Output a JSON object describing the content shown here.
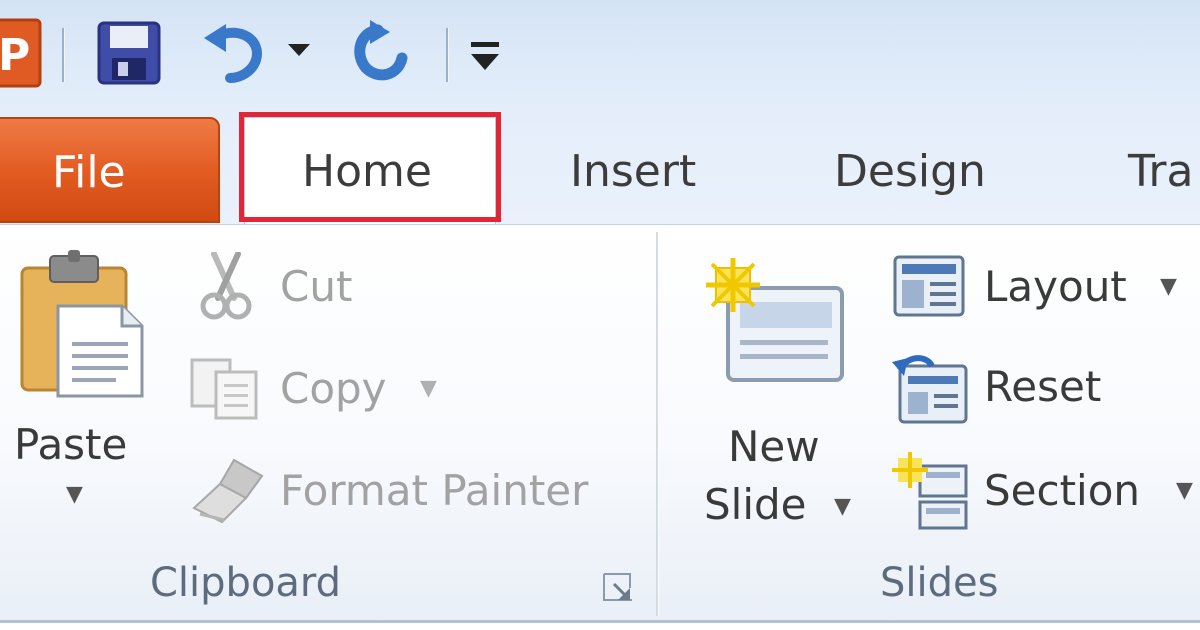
{
  "qat": {
    "save": "save-icon",
    "undo": "undo-icon",
    "redo": "redo-icon"
  },
  "tabs": {
    "file": "File",
    "home": "Home",
    "insert": "Insert",
    "design": "Design",
    "transitions": "Tra"
  },
  "clipboard": {
    "paste_label": "Paste",
    "cut_label": "Cut",
    "copy_label": "Copy",
    "format_painter_label": "Format Painter",
    "group_label": "Clipboard"
  },
  "slides": {
    "new_slide_line1": "New",
    "new_slide_line2": "Slide",
    "layout_label": "Layout",
    "reset_label": "Reset",
    "section_label": "Section",
    "group_label": "Slides"
  },
  "colors": {
    "file_tab": "#e15a20",
    "highlight": "#e32636",
    "titlebar": "#dce9f8"
  }
}
